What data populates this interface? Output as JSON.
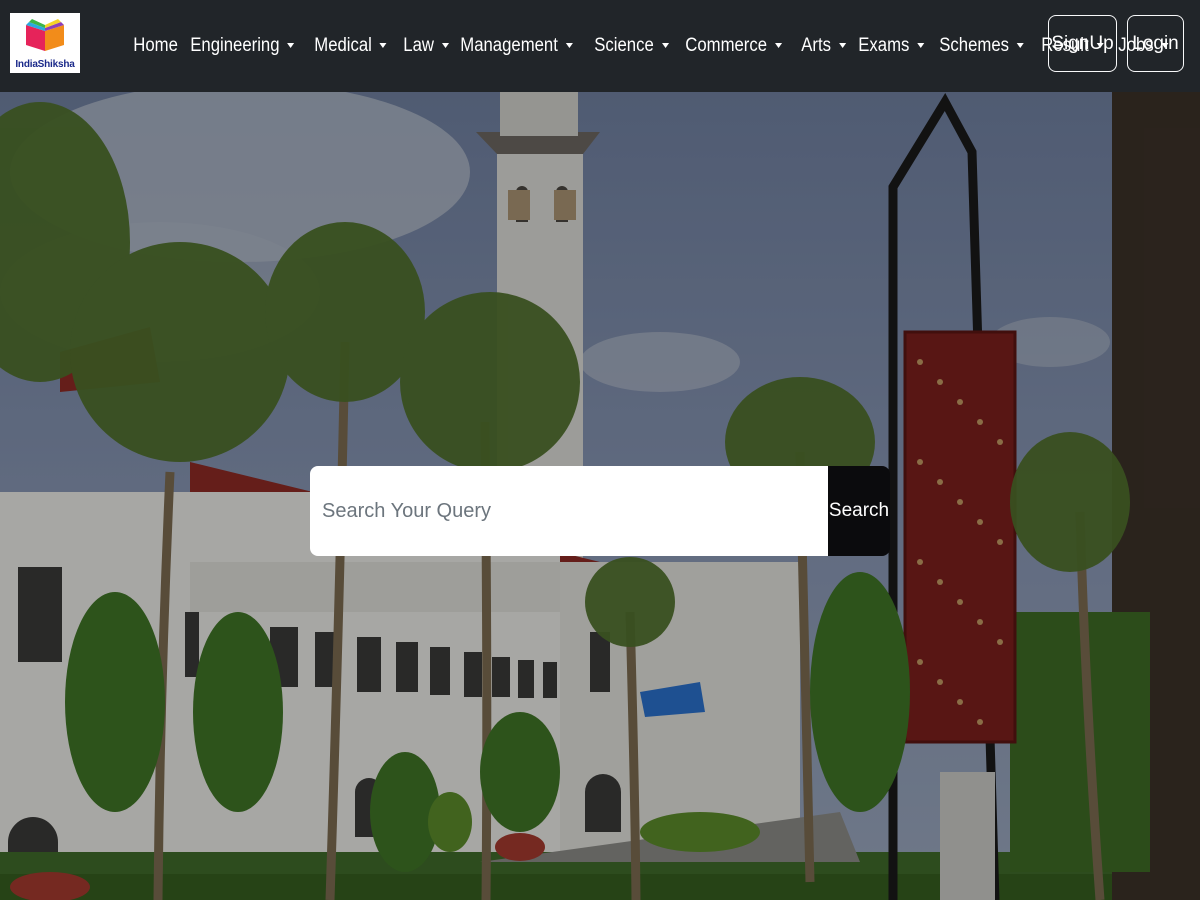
{
  "brand": {
    "logo_text": "IndiaShiksha"
  },
  "nav": {
    "items": [
      {
        "label": "Home",
        "dropdown": false
      },
      {
        "label": "Engineering",
        "dropdown": true
      },
      {
        "label": "Medical",
        "dropdown": true
      },
      {
        "label": "Law",
        "dropdown": true
      },
      {
        "label": "Management",
        "dropdown": true
      },
      {
        "label": "Science",
        "dropdown": true
      },
      {
        "label": "Commerce",
        "dropdown": true
      },
      {
        "label": "Arts",
        "dropdown": true
      },
      {
        "label": "Exams",
        "dropdown": true
      },
      {
        "label": "Schemes",
        "dropdown": true
      },
      {
        "label": "Result",
        "dropdown": true
      },
      {
        "label": "Jobs",
        "dropdown": true
      }
    ],
    "signup_label": "SignUp",
    "login_label": "Login"
  },
  "search": {
    "placeholder": "Search Your Query",
    "value": "",
    "button_label": "Search"
  },
  "colors": {
    "navbar_bg": "#212529",
    "search_button_bg": "#0b0b0d",
    "roof_red": "#8c2a24",
    "sky": "#5d6a86"
  },
  "hero": {
    "image": "campus-building-with-clock-tower-and-palm-trees"
  }
}
